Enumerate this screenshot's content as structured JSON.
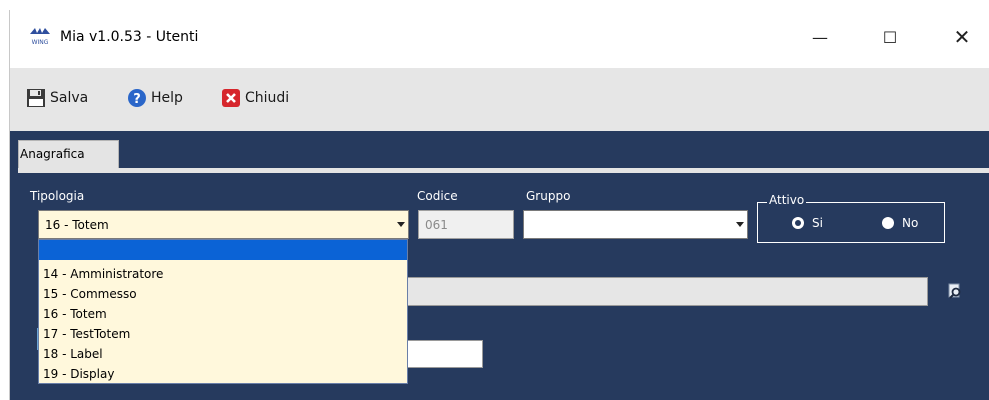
{
  "window": {
    "title": "Mia v1.0.53 - Utenti",
    "controls": {
      "minimize": "—",
      "maximize": "☐",
      "close": "✕"
    }
  },
  "toolbar": {
    "save_label": "Salva",
    "help_label": "Help",
    "close_label": "Chiudi"
  },
  "tabs": [
    {
      "label": "Anagrafica",
      "active": true
    }
  ],
  "form": {
    "tipologia": {
      "label": "Tipologia",
      "value": "16 - Totem",
      "options": [
        "",
        "14 - Amministratore",
        "15 - Commesso",
        "16 - Totem",
        "17 - TestTotem",
        "18 - Label",
        "19 - Display"
      ]
    },
    "codice": {
      "label": "Codice",
      "value": "061"
    },
    "gruppo": {
      "label": "Gruppo",
      "value": ""
    },
    "attivo": {
      "legend": "Attivo",
      "options": [
        {
          "label": "Si",
          "checked": true
        },
        {
          "label": "No",
          "checked": false
        }
      ]
    }
  },
  "colors": {
    "panel": "#263a5e",
    "combo_bg": "#fff8dc",
    "selection": "#0b63d6"
  },
  "icons": {
    "app": "wing-logo-icon",
    "save": "floppy-disk-icon",
    "help": "question-mark-icon",
    "close": "red-x-icon",
    "lookup": "magnifier-icon"
  }
}
